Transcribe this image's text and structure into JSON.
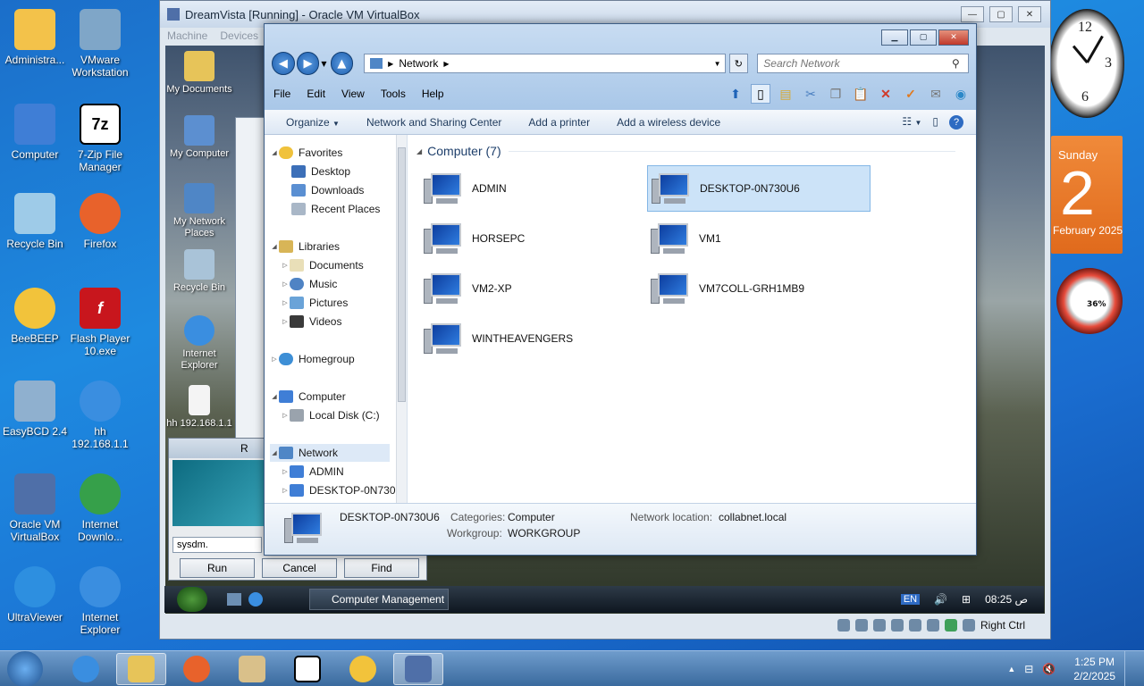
{
  "host_desktop": {
    "icons": [
      {
        "label": "Administra...",
        "color": "#f3c24a",
        "left": 0
      },
      {
        "label": "VMware Workstation",
        "color": "#7fa6c8"
      },
      {
        "label": "Computer",
        "color": "#3f7ed6"
      },
      {
        "label": "7-Zip File Manager",
        "glyph": "7z"
      },
      {
        "label": "Recycle Bin",
        "color": "#9ecbe8"
      },
      {
        "label": "Firefox",
        "color": "#e8622b"
      },
      {
        "label": "BeeBEEP",
        "color": "#f2c33b"
      },
      {
        "label": "Flash Player 10.exe",
        "glyph": "f"
      },
      {
        "label": "EasyBCD 2.4",
        "color": "#8fb0cf"
      },
      {
        "label": "hh 192.168.1.1",
        "color": "#3a8ee0"
      },
      {
        "label": "Oracle VM VirtualBox",
        "color": "#4f6fa8"
      },
      {
        "label": "Internet Downlo...",
        "color": "#36a04a"
      },
      {
        "label": "UltraViewer",
        "color": "#2d8fe0"
      },
      {
        "label": "Internet Explorer",
        "color": "#3a8ee0"
      }
    ]
  },
  "vbox": {
    "title": "DreamVista [Running] - Oracle VM VirtualBox",
    "menu": [
      "Machine",
      "Devices"
    ],
    "status_host_key": "Right Ctrl"
  },
  "guest_desktop": {
    "icons": [
      "My Documents",
      "My Computer",
      "My Network Places",
      "Recycle Bin",
      "Internet Explorer",
      "hh 192.168.1.1"
    ]
  },
  "gadgets": {
    "clock_numbers": [
      "12",
      "3",
      "6"
    ],
    "calendar_day": "Sunday",
    "calendar_date": "2",
    "calendar_month": "February 2025",
    "cpu_meter": "36%"
  },
  "explorer": {
    "address": {
      "icon": "network-icon",
      "path": "Network"
    },
    "search_placeholder": "Search Network",
    "menu": [
      "File",
      "Edit",
      "View",
      "Tools",
      "Help"
    ],
    "commands": [
      "Organize",
      "Network and Sharing Center",
      "Add a printer",
      "Add a wireless device"
    ],
    "nav": {
      "favorites": "Favorites",
      "favorites_items": [
        "Desktop",
        "Downloads",
        "Recent Places"
      ],
      "libraries": "Libraries",
      "libraries_items": [
        "Documents",
        "Music",
        "Pictures",
        "Videos"
      ],
      "homegroup": "Homegroup",
      "computer": "Computer",
      "computer_items": [
        "Local Disk (C:)"
      ],
      "network": "Network",
      "network_items": [
        "ADMIN",
        "DESKTOP-0N730"
      ]
    },
    "group_header": "Computer (7)",
    "computers": [
      "ADMIN",
      "DESKTOP-0N730U6",
      "HORSEPC",
      "VM1",
      "VM2-XP",
      "VM7COLL-GRH1MB9",
      "WINTHEAVENGERS"
    ],
    "selected": "DESKTOP-0N730U6",
    "details": {
      "name": "DESKTOP-0N730U6",
      "categories_label": "Categories:",
      "categories_value": "Computer",
      "workgroup_label": "Workgroup:",
      "workgroup_value": "WORKGROUP",
      "location_label": "Network location:",
      "location_value": "collabnet.local"
    }
  },
  "run_dialog": {
    "title_fragment": "R",
    "input_value": "sysdm.",
    "buttons": [
      "Run",
      "Cancel",
      "Find"
    ]
  },
  "guest_taskbar": {
    "task": "Computer Management",
    "lang": "EN",
    "time": "08:25",
    "ampm": "ص"
  },
  "host_taskbar": {
    "time": "1:25 PM",
    "date": "2/2/2025"
  }
}
